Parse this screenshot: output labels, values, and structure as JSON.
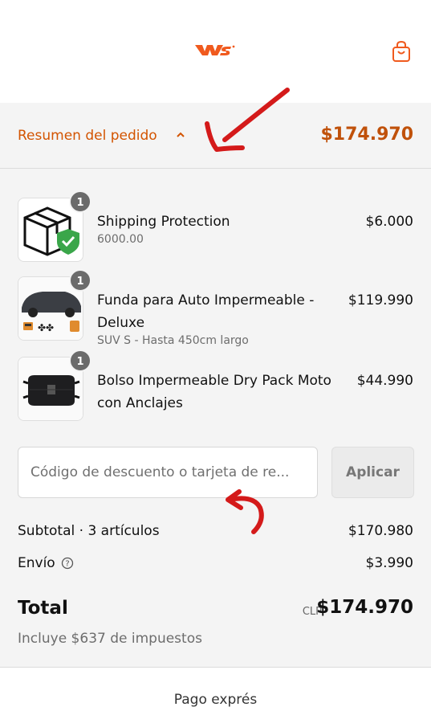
{
  "header": {
    "logo_icon": "brand-logo",
    "cart_icon": "shopping-bag-icon",
    "accent_color": "#f05a1e"
  },
  "summary": {
    "toggle_label": "Resumen del pedido",
    "toggle_icon": "chevron-up-icon",
    "total": "$174.970",
    "accent_color": "#c0510a"
  },
  "items": [
    {
      "name": "Shipping Protection",
      "variant": "6000.00",
      "price": "$6.000",
      "quantity": "1"
    },
    {
      "name": "Funda para Auto Impermeable - Deluxe",
      "variant": "SUV S - Hasta 450cm largo",
      "price": "$119.990",
      "quantity": "1"
    },
    {
      "name": "Bolso Impermeable Dry Pack Moto con Anclajes",
      "variant": "",
      "price": "$44.990",
      "quantity": "1"
    }
  ],
  "discount": {
    "placeholder": "Código de descuento o tarjeta de re...",
    "apply_label": "Aplicar"
  },
  "totals": {
    "subtotal_label": "Subtotal · 3 artículos",
    "subtotal_value": "$170.980",
    "shipping_label": "Envío",
    "shipping_value": "$3.990",
    "total_label": "Total",
    "currency": "CLP",
    "total_value": "$174.970",
    "taxes_note": "Incluye $637 de impuestos"
  },
  "express": {
    "label": "Pago exprés"
  },
  "annotations": {
    "color": "#d41a1a"
  }
}
